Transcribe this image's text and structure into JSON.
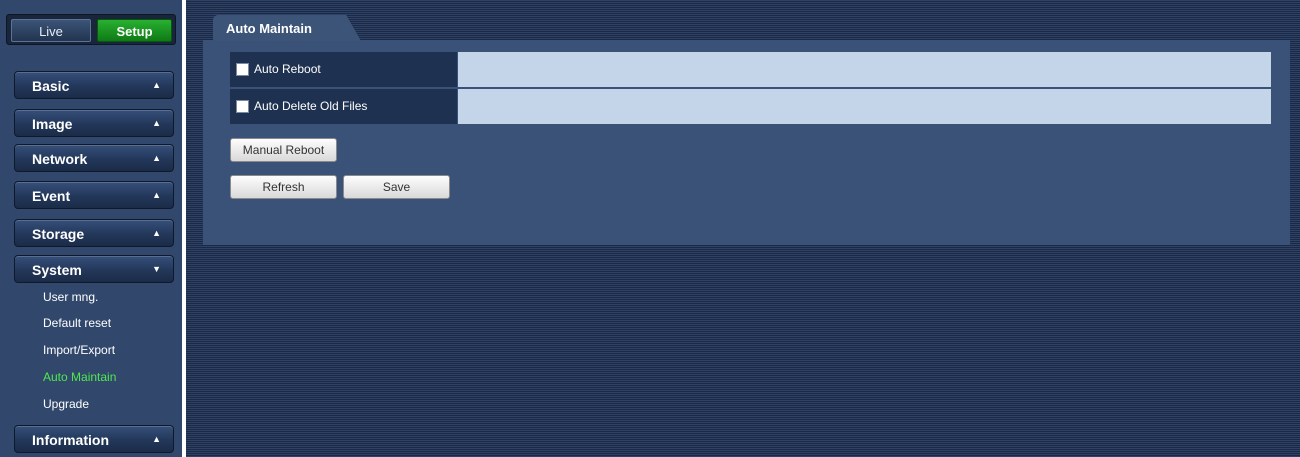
{
  "mode": {
    "live_label": "Live",
    "setup_label": "Setup",
    "active": "Setup"
  },
  "sidebar": {
    "menus": [
      {
        "label": "Basic",
        "arrow": "▲"
      },
      {
        "label": "Image",
        "arrow": "▲"
      },
      {
        "label": "Network",
        "arrow": "▲"
      },
      {
        "label": "Event",
        "arrow": "▲"
      },
      {
        "label": "Storage",
        "arrow": "▲"
      },
      {
        "label": "System",
        "arrow": "▼"
      },
      {
        "label": "Information",
        "arrow": "▲"
      }
    ],
    "system_items": [
      {
        "label": "User mng."
      },
      {
        "label": "Default reset"
      },
      {
        "label": "Import/Export"
      },
      {
        "label": "Auto Maintain",
        "active": true
      },
      {
        "label": "Upgrade"
      }
    ]
  },
  "main": {
    "tab_title": "Auto Maintain",
    "options": [
      {
        "label": "Auto Reboot",
        "checked": false
      },
      {
        "label": "Auto Delete Old Files",
        "checked": false
      }
    ],
    "buttons": {
      "manual_reboot": "Manual Reboot",
      "refresh": "Refresh",
      "save": "Save"
    }
  },
  "colors": {
    "active_item": "#4ee84e",
    "setup_active": "#1a9a22",
    "panel_bg": "#3a5277",
    "field_bg": "#c5d5e9"
  }
}
